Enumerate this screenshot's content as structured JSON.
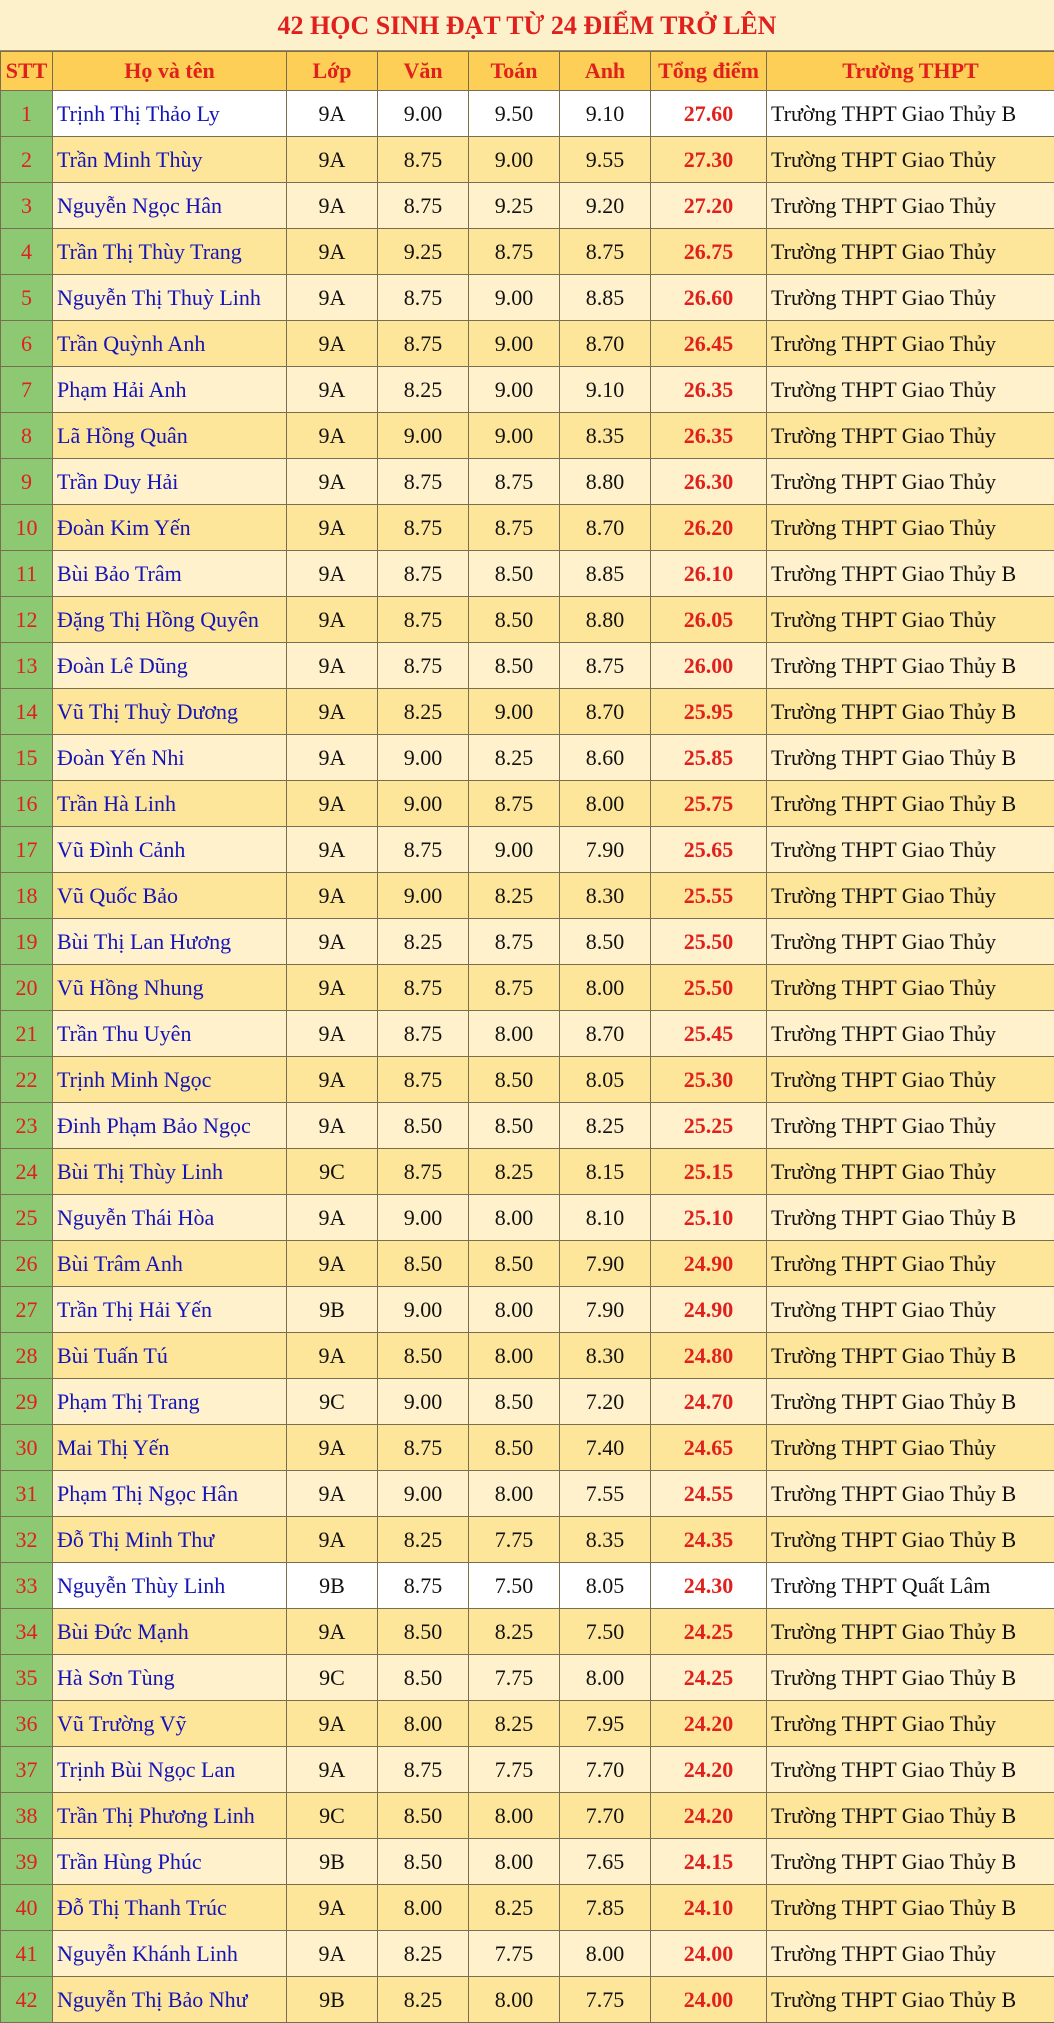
{
  "title": "42 HỌC SINH ĐẠT TỪ 24 ĐIỂM TRỞ LÊN",
  "headers": [
    "STT",
    "Họ và tên",
    "Lớp",
    "Văn",
    "Toán",
    "Anh",
    "Tổng điểm",
    "Trường THPT"
  ],
  "rows": [
    [
      "1",
      "Trịnh Thị Thảo Ly",
      "9A",
      "9.00",
      "9.50",
      "9.10",
      "27.60",
      "Trường THPT Giao Thủy B"
    ],
    [
      "2",
      "Trần Minh Thùy",
      "9A",
      "8.75",
      "9.00",
      "9.55",
      "27.30",
      "Trường THPT Giao Thủy"
    ],
    [
      "3",
      "Nguyễn Ngọc Hân",
      "9A",
      "8.75",
      "9.25",
      "9.20",
      "27.20",
      "Trường THPT Giao Thủy"
    ],
    [
      "4",
      "Trần Thị Thùy Trang",
      "9A",
      "9.25",
      "8.75",
      "8.75",
      "26.75",
      "Trường THPT Giao Thủy"
    ],
    [
      "5",
      "Nguyễn Thị Thuỳ Linh",
      "9A",
      "8.75",
      "9.00",
      "8.85",
      "26.60",
      "Trường THPT Giao Thủy"
    ],
    [
      "6",
      "Trần Quỳnh Anh",
      "9A",
      "8.75",
      "9.00",
      "8.70",
      "26.45",
      "Trường THPT Giao Thủy"
    ],
    [
      "7",
      "Phạm Hải Anh",
      "9A",
      "8.25",
      "9.00",
      "9.10",
      "26.35",
      "Trường THPT Giao Thủy"
    ],
    [
      "8",
      "Lã Hồng Quân",
      "9A",
      "9.00",
      "9.00",
      "8.35",
      "26.35",
      "Trường THPT Giao Thủy"
    ],
    [
      "9",
      "Trần Duy Hải",
      "9A",
      "8.75",
      "8.75",
      "8.80",
      "26.30",
      "Trường THPT Giao Thủy"
    ],
    [
      "10",
      "Đoàn Kim Yến",
      "9A",
      "8.75",
      "8.75",
      "8.70",
      "26.20",
      "Trường THPT Giao Thủy"
    ],
    [
      "11",
      "Bùi Bảo Trâm",
      "9A",
      "8.75",
      "8.50",
      "8.85",
      "26.10",
      "Trường THPT Giao Thủy B"
    ],
    [
      "12",
      "Đặng Thị Hồng Quyên",
      "9A",
      "8.75",
      "8.50",
      "8.80",
      "26.05",
      "Trường THPT Giao Thủy"
    ],
    [
      "13",
      "Đoàn Lê Dũng",
      "9A",
      "8.75",
      "8.50",
      "8.75",
      "26.00",
      "Trường THPT Giao Thủy B"
    ],
    [
      "14",
      "Vũ Thị Thuỳ Dương",
      "9A",
      "8.25",
      "9.00",
      "8.70",
      "25.95",
      "Trường THPT Giao Thủy B"
    ],
    [
      "15",
      "Đoàn Yến Nhi",
      "9A",
      "9.00",
      "8.25",
      "8.60",
      "25.85",
      "Trường THPT Giao Thủy B"
    ],
    [
      "16",
      "Trần Hà Linh",
      "9A",
      "9.00",
      "8.75",
      "8.00",
      "25.75",
      "Trường THPT Giao Thủy B"
    ],
    [
      "17",
      "Vũ Đình Cảnh",
      "9A",
      "8.75",
      "9.00",
      "7.90",
      "25.65",
      "Trường THPT Giao Thủy"
    ],
    [
      "18",
      "Vũ Quốc Bảo",
      "9A",
      "9.00",
      "8.25",
      "8.30",
      "25.55",
      "Trường THPT Giao Thủy"
    ],
    [
      "19",
      "Bùi Thị Lan Hương",
      "9A",
      "8.25",
      "8.75",
      "8.50",
      "25.50",
      "Trường THPT Giao Thủy"
    ],
    [
      "20",
      "Vũ Hồng Nhung",
      "9A",
      "8.75",
      "8.75",
      "8.00",
      "25.50",
      "Trường THPT Giao Thủy"
    ],
    [
      "21",
      "Trần Thu Uyên",
      "9A",
      "8.75",
      "8.00",
      "8.70",
      "25.45",
      "Trường THPT Giao Thủy"
    ],
    [
      "22",
      "Trịnh Minh Ngọc",
      "9A",
      "8.75",
      "8.50",
      "8.05",
      "25.30",
      "Trường THPT Giao Thủy"
    ],
    [
      "23",
      "Đinh Phạm Bảo Ngọc",
      "9A",
      "8.50",
      "8.50",
      "8.25",
      "25.25",
      "Trường THPT Giao Thủy"
    ],
    [
      "24",
      "Bùi Thị Thùy Linh",
      "9C",
      "8.75",
      "8.25",
      "8.15",
      "25.15",
      "Trường THPT Giao Thủy"
    ],
    [
      "25",
      "Nguyễn Thái Hòa",
      "9A",
      "9.00",
      "8.00",
      "8.10",
      "25.10",
      "Trường THPT Giao Thủy B"
    ],
    [
      "26",
      "Bùi Trâm Anh",
      "9A",
      "8.50",
      "8.50",
      "7.90",
      "24.90",
      "Trường THPT Giao Thủy"
    ],
    [
      "27",
      "Trần Thị Hải Yến",
      "9B",
      "9.00",
      "8.00",
      "7.90",
      "24.90",
      "Trường THPT Giao Thủy"
    ],
    [
      "28",
      "Bùi Tuấn Tú",
      "9A",
      "8.50",
      "8.00",
      "8.30",
      "24.80",
      "Trường THPT Giao Thủy B"
    ],
    [
      "29",
      "Phạm Thị Trang",
      "9C",
      "9.00",
      "8.50",
      "7.20",
      "24.70",
      "Trường THPT Giao Thủy B"
    ],
    [
      "30",
      "Mai Thị Yến",
      "9A",
      "8.75",
      "8.50",
      "7.40",
      "24.65",
      "Trường THPT Giao Thủy"
    ],
    [
      "31",
      "Phạm Thị Ngọc Hân",
      "9A",
      "9.00",
      "8.00",
      "7.55",
      "24.55",
      "Trường THPT Giao Thủy B"
    ],
    [
      "32",
      "Đỗ Thị Minh Thư",
      "9A",
      "8.25",
      "7.75",
      "8.35",
      "24.35",
      "Trường THPT Giao Thủy B"
    ],
    [
      "33",
      "Nguyễn Thùy Linh",
      "9B",
      "8.75",
      "7.50",
      "8.05",
      "24.30",
      "Trường THPT Quất Lâm"
    ],
    [
      "34",
      "Bùi Đức Mạnh",
      "9A",
      "8.50",
      "8.25",
      "7.50",
      "24.25",
      "Trường THPT Giao Thủy B"
    ],
    [
      "35",
      "Hà Sơn Tùng",
      "9C",
      "8.50",
      "7.75",
      "8.00",
      "24.25",
      "Trường THPT Giao Thủy B"
    ],
    [
      "36",
      "Vũ Trường Vỹ",
      "9A",
      "8.00",
      "8.25",
      "7.95",
      "24.20",
      "Trường THPT Giao Thủy"
    ],
    [
      "37",
      "Trịnh Bùi Ngọc Lan",
      "9A",
      "8.75",
      "7.75",
      "7.70",
      "24.20",
      "Trường THPT Giao Thủy B"
    ],
    [
      "38",
      "Trần Thị Phương Linh",
      "9C",
      "8.50",
      "8.00",
      "7.70",
      "24.20",
      "Trường THPT Giao Thủy B"
    ],
    [
      "39",
      "Trần Hùng Phúc",
      "9B",
      "8.50",
      "8.00",
      "7.65",
      "24.15",
      "Trường THPT Giao Thủy B"
    ],
    [
      "40",
      "Đỗ Thị Thanh Trúc",
      "9A",
      "8.00",
      "8.25",
      "7.85",
      "24.10",
      "Trường THPT Giao Thủy B"
    ],
    [
      "41",
      "Nguyễn Khánh Linh",
      "9A",
      "8.25",
      "7.75",
      "8.00",
      "24.00",
      "Trường THPT Giao Thủy"
    ],
    [
      "42",
      "Nguyễn Thị Bảo Như",
      "9B",
      "8.25",
      "8.00",
      "7.75",
      "24.00",
      "Trường THPT Giao Thủy B"
    ]
  ],
  "highlighted_rows": [
    "1",
    "33"
  ],
  "colors": {
    "title_red": "#e0201d",
    "header_bg": "#fecf56",
    "stt_green": "#8dc873",
    "name_blue": "#1414b8",
    "row_light": "#fef1cb",
    "row_dark": "#fde59a"
  }
}
